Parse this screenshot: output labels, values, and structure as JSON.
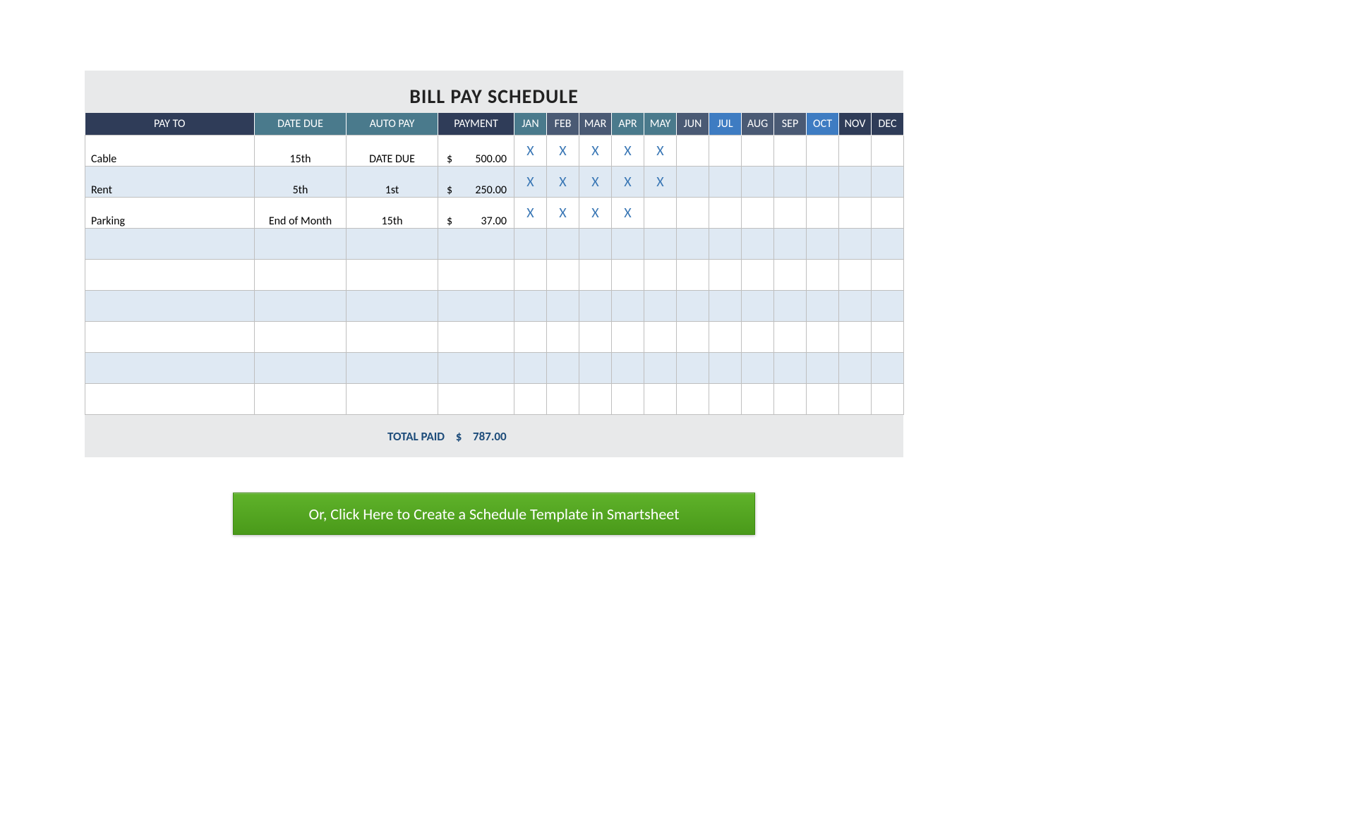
{
  "title": "BILL PAY SCHEDULE",
  "headers": {
    "payto": "PAY TO",
    "due": "DATE DUE",
    "auto": "AUTO PAY",
    "payment": "PAYMENT",
    "months": [
      "JAN",
      "FEB",
      "MAR",
      "APR",
      "MAY",
      "JUN",
      "JUL",
      "AUG",
      "SEP",
      "OCT",
      "NOV",
      "DEC"
    ]
  },
  "month_styles": [
    "teal",
    "dark",
    "dark",
    "teal",
    "teal",
    "dark",
    "blue",
    "dark",
    "dark",
    "blue",
    "db",
    "db"
  ],
  "rows": [
    {
      "payto": "Cable",
      "due": "15th",
      "auto": "DATE DUE",
      "currency": "$",
      "amount": "500.00",
      "months": [
        "X",
        "X",
        "X",
        "X",
        "X",
        "",
        "",
        "",
        "",
        "",
        "",
        ""
      ]
    },
    {
      "payto": "Rent",
      "due": "5th",
      "auto": "1st",
      "currency": "$",
      "amount": "250.00",
      "months": [
        "X",
        "X",
        "X",
        "X",
        "X",
        "",
        "",
        "",
        "",
        "",
        "",
        ""
      ]
    },
    {
      "payto": "Parking",
      "due": "End of Month",
      "auto": "15th",
      "currency": "$",
      "amount": "37.00",
      "months": [
        "X",
        "X",
        "X",
        "X",
        "",
        "",
        "",
        "",
        "",
        "",
        "",
        ""
      ]
    },
    {
      "payto": "",
      "due": "",
      "auto": "",
      "currency": "",
      "amount": "",
      "months": [
        "",
        "",
        "",
        "",
        "",
        "",
        "",
        "",
        "",
        "",
        "",
        ""
      ]
    },
    {
      "payto": "",
      "due": "",
      "auto": "",
      "currency": "",
      "amount": "",
      "months": [
        "",
        "",
        "",
        "",
        "",
        "",
        "",
        "",
        "",
        "",
        "",
        ""
      ]
    },
    {
      "payto": "",
      "due": "",
      "auto": "",
      "currency": "",
      "amount": "",
      "months": [
        "",
        "",
        "",
        "",
        "",
        "",
        "",
        "",
        "",
        "",
        "",
        ""
      ]
    },
    {
      "payto": "",
      "due": "",
      "auto": "",
      "currency": "",
      "amount": "",
      "months": [
        "",
        "",
        "",
        "",
        "",
        "",
        "",
        "",
        "",
        "",
        "",
        ""
      ]
    },
    {
      "payto": "",
      "due": "",
      "auto": "",
      "currency": "",
      "amount": "",
      "months": [
        "",
        "",
        "",
        "",
        "",
        "",
        "",
        "",
        "",
        "",
        "",
        ""
      ]
    },
    {
      "payto": "",
      "due": "",
      "auto": "",
      "currency": "",
      "amount": "",
      "months": [
        "",
        "",
        "",
        "",
        "",
        "",
        "",
        "",
        "",
        "",
        "",
        ""
      ]
    }
  ],
  "total": {
    "label": "TOTAL PAID",
    "currency": "$",
    "amount": "787.00"
  },
  "cta": "Or, Click Here to Create a Schedule Template in Smartsheet"
}
